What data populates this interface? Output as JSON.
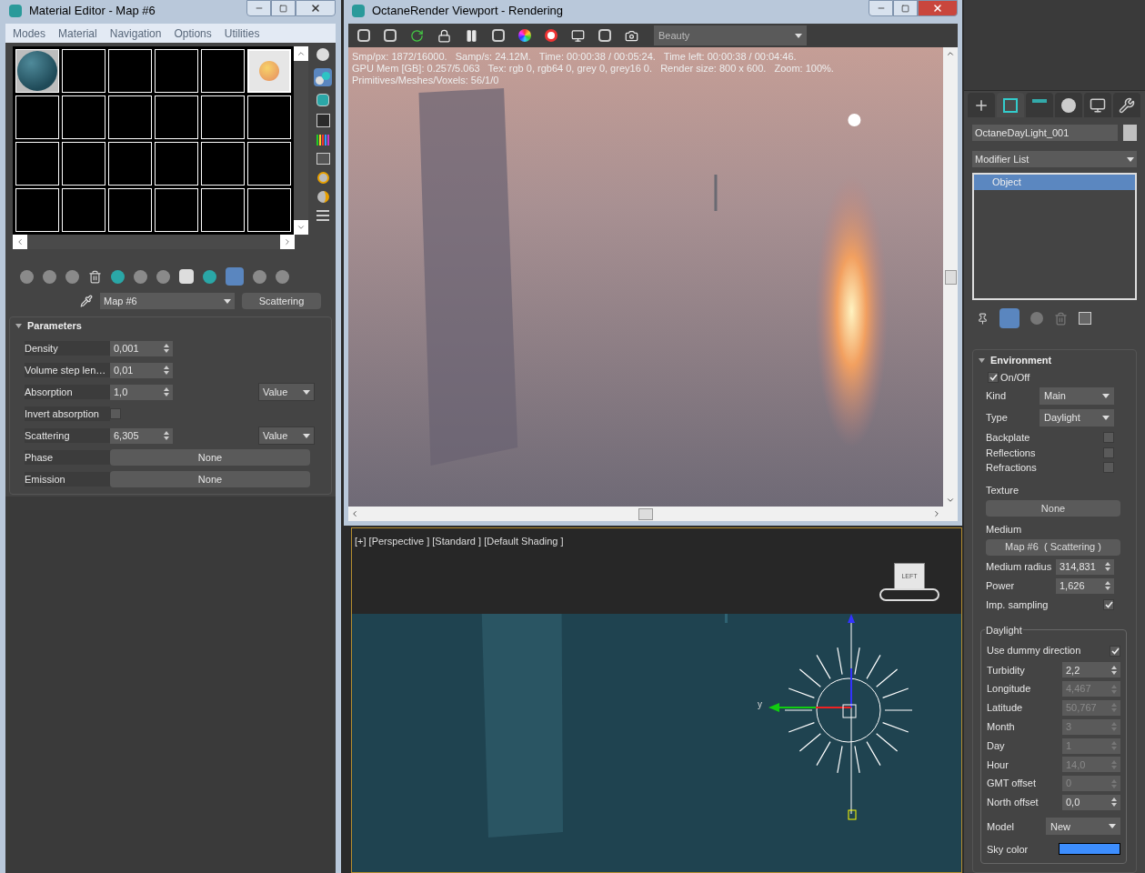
{
  "material_editor": {
    "title": "Material Editor - Map #6",
    "menu": [
      "Modes",
      "Material",
      "Navigation",
      "Options",
      "Utilities"
    ],
    "slots": [
      {
        "kind": "sphere",
        "selected": false
      },
      {
        "kind": "empty",
        "selected": false
      },
      {
        "kind": "empty",
        "selected": false
      },
      {
        "kind": "empty",
        "selected": false
      },
      {
        "kind": "empty",
        "selected": false
      },
      {
        "kind": "map",
        "selected": true
      },
      {
        "kind": "empty",
        "selected": false
      },
      {
        "kind": "empty",
        "selected": false
      },
      {
        "kind": "empty",
        "selected": false
      },
      {
        "kind": "empty",
        "selected": false
      },
      {
        "kind": "empty",
        "selected": false
      },
      {
        "kind": "empty",
        "selected": false
      },
      {
        "kind": "empty",
        "selected": false
      },
      {
        "kind": "empty",
        "selected": false
      },
      {
        "kind": "empty",
        "selected": false
      },
      {
        "kind": "empty",
        "selected": false
      },
      {
        "kind": "empty",
        "selected": false
      },
      {
        "kind": "empty",
        "selected": false
      },
      {
        "kind": "empty",
        "selected": false
      },
      {
        "kind": "empty",
        "selected": false
      },
      {
        "kind": "empty",
        "selected": false
      },
      {
        "kind": "empty",
        "selected": false
      },
      {
        "kind": "empty",
        "selected": false
      },
      {
        "kind": "empty",
        "selected": false
      }
    ],
    "map_name": "Map #6",
    "map_type": "Scattering",
    "parameters": {
      "title": "Parameters",
      "expanded": true,
      "rows": [
        {
          "kind": "spinner",
          "label": "Density",
          "value": "0,001"
        },
        {
          "kind": "spinner",
          "label": "Volume step len…",
          "value": "0,01"
        },
        {
          "kind": "spinner",
          "label": "Absorption",
          "value": "1,0",
          "mode": "Value"
        },
        {
          "kind": "checkbox",
          "label": "Invert absorption",
          "checked": false
        },
        {
          "kind": "spinner",
          "label": "Scattering",
          "value": "6,305",
          "mode": "Value"
        },
        {
          "kind": "button",
          "label": "Phase",
          "value": "None"
        },
        {
          "kind": "button",
          "label": "Emission",
          "value": "None"
        }
      ]
    }
  },
  "render_window": {
    "title": "OctaneRender Viewport - Rendering",
    "pass": "Beauty",
    "stats": [
      "Smp/px: 1872/16000.   Samp/s: 24.12M.   Time: 00:00:38 / 00:05:24.   Time left: 00:00:38 / 00:04:46.",
      "GPU Mem [GB]: 0.257/5.063   Tex: rgb 0, rgb64 0, grey 0, grey16 0.   Render size: 800 x 600.   Zoom: 100%.",
      "Primitives/Meshes/Voxels: 56/1/0"
    ]
  },
  "viewport": {
    "label": "[+] [Perspective ] [Standard ] [Default Shading ]",
    "nav_cube": "LEFT",
    "gizmo_axis": "y"
  },
  "command_panel": {
    "tabs": [
      {
        "selected": false
      },
      {
        "selected": true
      },
      {
        "selected": false
      },
      {
        "selected": false
      },
      {
        "selected": false
      },
      {
        "selected": false
      }
    ],
    "object_name": "OctaneDayLight_001",
    "modifier_list": "Modifier List",
    "stack": [
      {
        "label": "Object",
        "selected": true
      }
    ],
    "environment": {
      "title": "Environment",
      "expanded": true,
      "on_off": {
        "label": "On/Off",
        "checked": true
      },
      "kind": {
        "label": "Kind",
        "value": "Main"
      },
      "type": {
        "label": "Type",
        "value": "Daylight"
      },
      "toggles": [
        {
          "label": "Backplate",
          "checked": false
        },
        {
          "label": "Reflections",
          "checked": false
        },
        {
          "label": "Refractions",
          "checked": false
        }
      ],
      "texture": {
        "label": "Texture",
        "value": "None"
      },
      "medium": {
        "label": "Medium",
        "value": "Map #6  ( Scattering )"
      },
      "spinners": [
        {
          "label": "Medium radius",
          "value": "314,831"
        },
        {
          "label": "Power",
          "value": "1,626"
        }
      ],
      "imp_sampling": {
        "label": "Imp. sampling",
        "checked": true
      },
      "daylight": {
        "title": "Daylight",
        "use_dummy": {
          "label": "Use dummy direction",
          "checked": true
        },
        "spinners": [
          {
            "label": "Turbidity",
            "value": "2,2",
            "disabled": false
          },
          {
            "label": "Longitude",
            "value": "4,467",
            "disabled": true
          },
          {
            "label": "Latitude",
            "value": "50,767",
            "disabled": true
          },
          {
            "label": "Month",
            "value": "3",
            "disabled": true
          },
          {
            "label": "Day",
            "value": "1",
            "disabled": true
          },
          {
            "label": "Hour",
            "value": "14,0",
            "disabled": true
          },
          {
            "label": "GMT offset",
            "value": "0",
            "disabled": true
          },
          {
            "label": "North offset",
            "value": "0,0",
            "disabled": false
          }
        ],
        "model": {
          "label": "Model",
          "value": "New"
        },
        "sky_color": {
          "label": "Sky color",
          "color": "#3d8eff"
        }
      }
    }
  }
}
